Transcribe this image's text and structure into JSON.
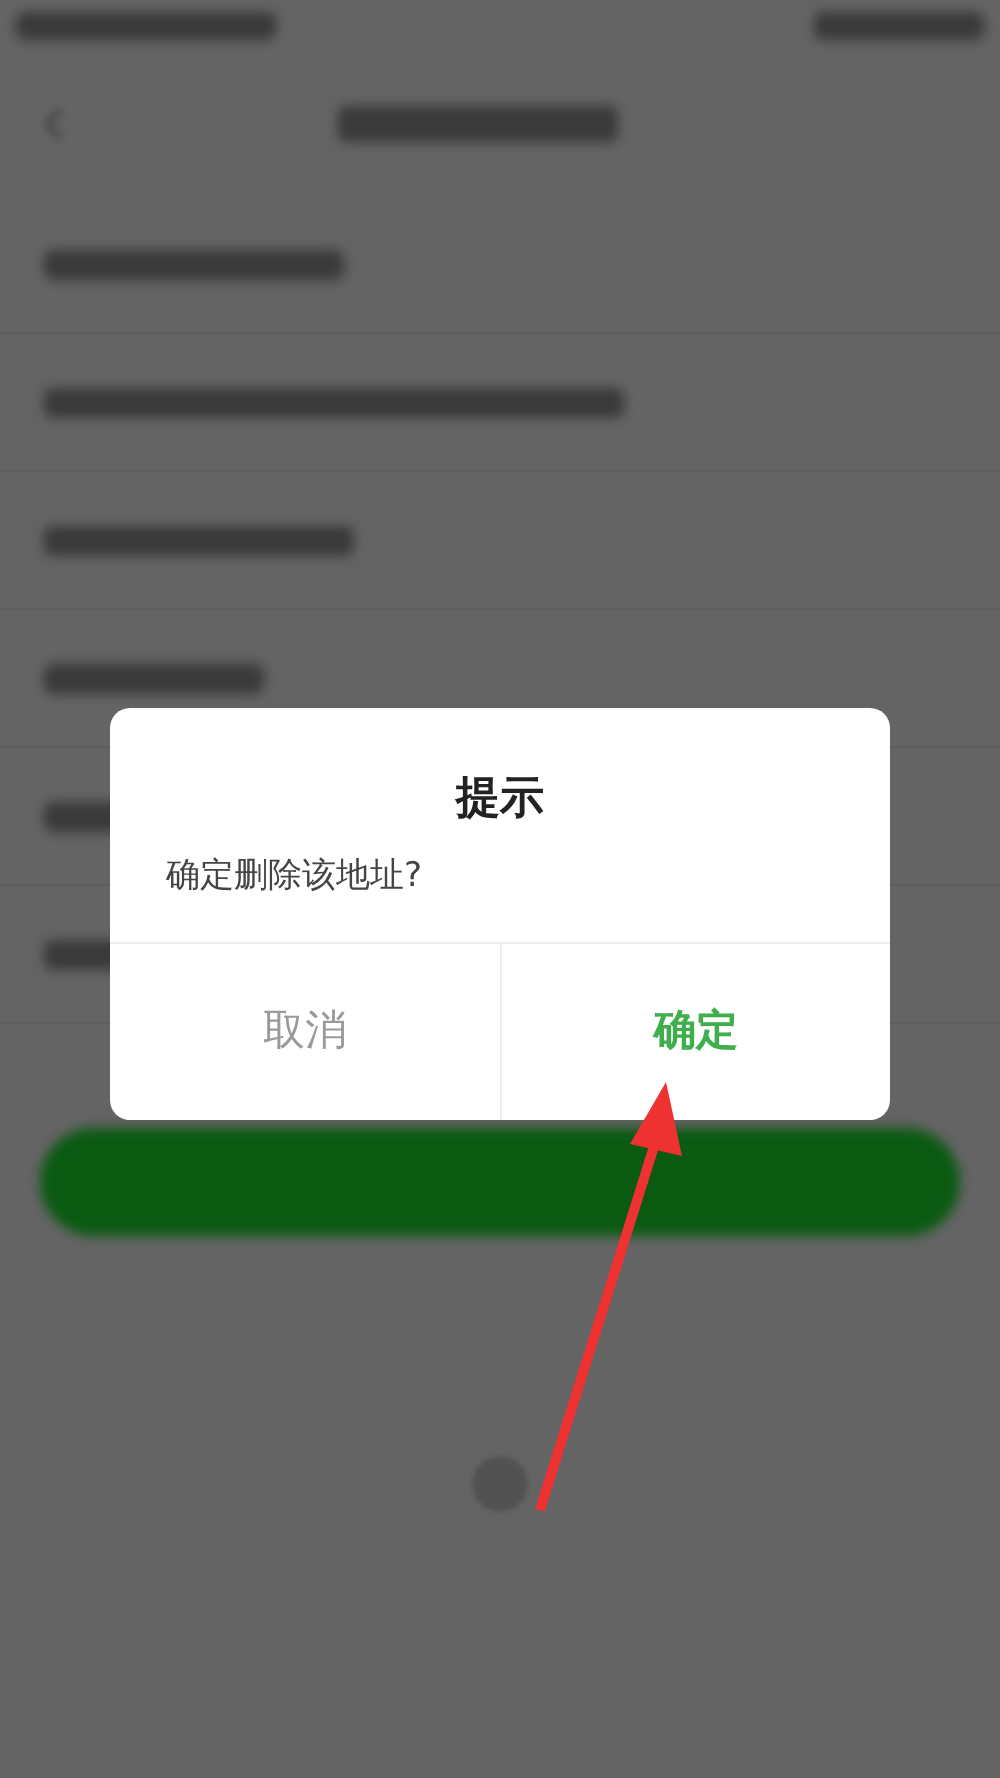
{
  "dialog": {
    "title": "提示",
    "message": "确定删除该地址?",
    "buttons": [
      {
        "label": "取消",
        "kind": "cancel"
      },
      {
        "label": "确定",
        "kind": "confirm"
      }
    ]
  }
}
